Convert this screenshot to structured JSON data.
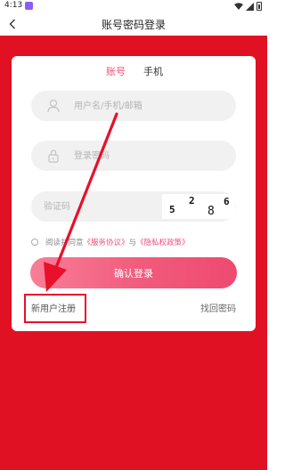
{
  "status_bar": {
    "time": "4:13"
  },
  "header": {
    "title": "账号密码登录",
    "back_icon": "chevron-left-icon"
  },
  "tabs": {
    "account": "账号",
    "phone": "手机"
  },
  "fields": {
    "username_placeholder": "用户名/手机/邮箱",
    "password_placeholder": "登录密码",
    "captcha_placeholder": "验证码",
    "captcha_digits": [
      "5",
      "2",
      "8",
      "6"
    ]
  },
  "agreement": {
    "prefix": "阅读并同意",
    "service": "《服务协议》",
    "and": "与",
    "privacy": "《隐私权政策》"
  },
  "buttons": {
    "confirm": "确认登录",
    "register": "新用户注册",
    "forgot": "找回密码"
  },
  "colors": {
    "background_red": "#e01123",
    "accent_pink": "#f0507a",
    "annotation_red": "#e8102a"
  }
}
